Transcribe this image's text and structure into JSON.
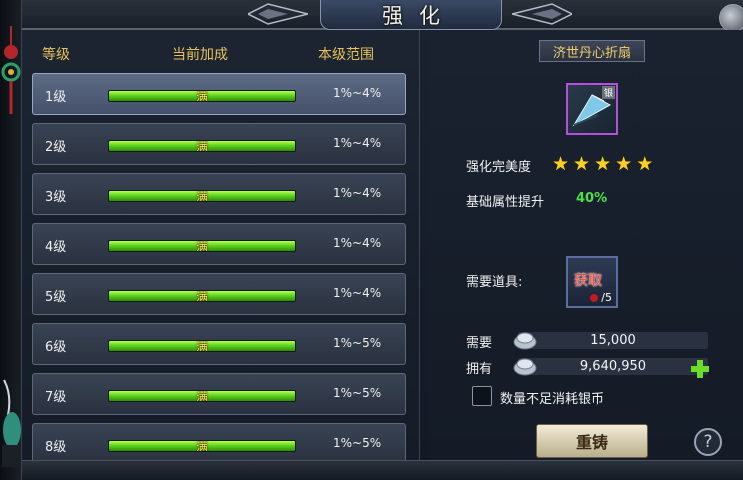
{
  "window": {
    "title": "强化"
  },
  "table": {
    "headers": {
      "level": "等级",
      "bonus": "当前加成",
      "range": "本级范围"
    },
    "rows": [
      {
        "level": "1级",
        "bar_label": "满",
        "fill": 1.0,
        "range": "1%~4%",
        "selected": true
      },
      {
        "level": "2级",
        "bar_label": "满",
        "fill": 1.0,
        "range": "1%~4%",
        "selected": false
      },
      {
        "level": "3级",
        "bar_label": "满",
        "fill": 1.0,
        "range": "1%~4%",
        "selected": false
      },
      {
        "level": "4级",
        "bar_label": "满",
        "fill": 1.0,
        "range": "1%~4%",
        "selected": false
      },
      {
        "level": "5级",
        "bar_label": "满",
        "fill": 1.0,
        "range": "1%~4%",
        "selected": false
      },
      {
        "level": "6级",
        "bar_label": "满",
        "fill": 1.0,
        "range": "1%~5%",
        "selected": false
      },
      {
        "level": "7级",
        "bar_label": "满",
        "fill": 1.0,
        "range": "1%~5%",
        "selected": false
      },
      {
        "level": "8级",
        "bar_label": "满",
        "fill": 1.0,
        "range": "1%~5%",
        "selected": false
      }
    ]
  },
  "item": {
    "name": "济世丹心折扇",
    "tag": "银",
    "icon": "fan-icon",
    "quality_color": "#b44fe0"
  },
  "stats": {
    "perfection_label": "强化完美度",
    "perfection_stars": 5,
    "base_label": "基础属性提升",
    "base_value": "40%"
  },
  "requirement": {
    "label": "需要道具:",
    "icon_text": "获取",
    "count": "/5"
  },
  "silver": {
    "need_label": "需要",
    "need_value": "15,000",
    "have_label": "拥有",
    "have_value": "9,640,950"
  },
  "option": {
    "label": "数量不足消耗银币",
    "checked": false
  },
  "buttons": {
    "reforge": "重铸",
    "help": "?"
  }
}
